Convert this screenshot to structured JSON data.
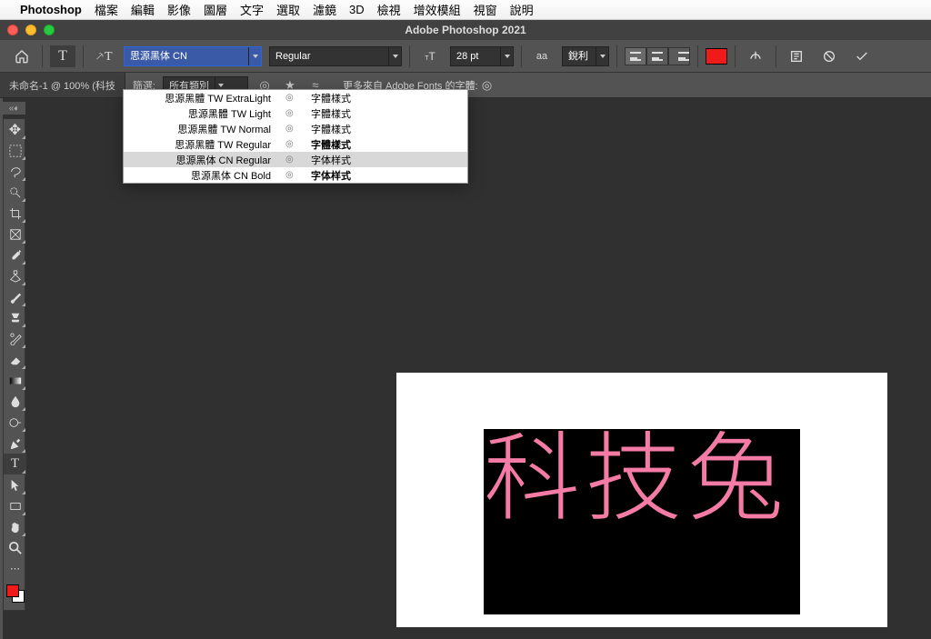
{
  "menubar": {
    "items": [
      "Photoshop",
      "檔案",
      "編輯",
      "影像",
      "圖層",
      "文字",
      "選取",
      "濾鏡",
      "3D",
      "檢視",
      "增效模組",
      "視窗",
      "說明"
    ]
  },
  "window": {
    "title": "Adobe Photoshop 2021"
  },
  "optbar": {
    "font_family": "思源黑体 CN",
    "font_style": "Regular",
    "font_size": "28 pt",
    "aa_label": "aa",
    "aa_mode": "銳利"
  },
  "doctab": {
    "label": "未命名-1 @ 100% (科技"
  },
  "filter": {
    "label": "篩選:",
    "value": "所有類別",
    "adobe_fonts": "更多來自 Adobe Fonts 的字體:"
  },
  "fonts": [
    {
      "name": "思源黑體 TW ExtraLight",
      "sample": "字體樣式",
      "bold": false,
      "sel": false
    },
    {
      "name": "思源黑體 TW Light",
      "sample": "字體樣式",
      "bold": false,
      "sel": false
    },
    {
      "name": "思源黑體 TW Normal",
      "sample": "字體樣式",
      "bold": false,
      "sel": false
    },
    {
      "name": "思源黑體 TW Regular",
      "sample": "字體樣式",
      "bold": true,
      "sel": false
    },
    {
      "name": "思源黑体 CN Regular",
      "sample": "字体样式",
      "bold": false,
      "sel": true
    },
    {
      "name": "思源黑体 CN Bold",
      "sample": "字体样式",
      "bold": true,
      "sel": false
    }
  ],
  "canvas": {
    "text": "科技兔"
  },
  "colors": {
    "text_color": "#f47ba5",
    "accent": "#ef1b1b"
  }
}
